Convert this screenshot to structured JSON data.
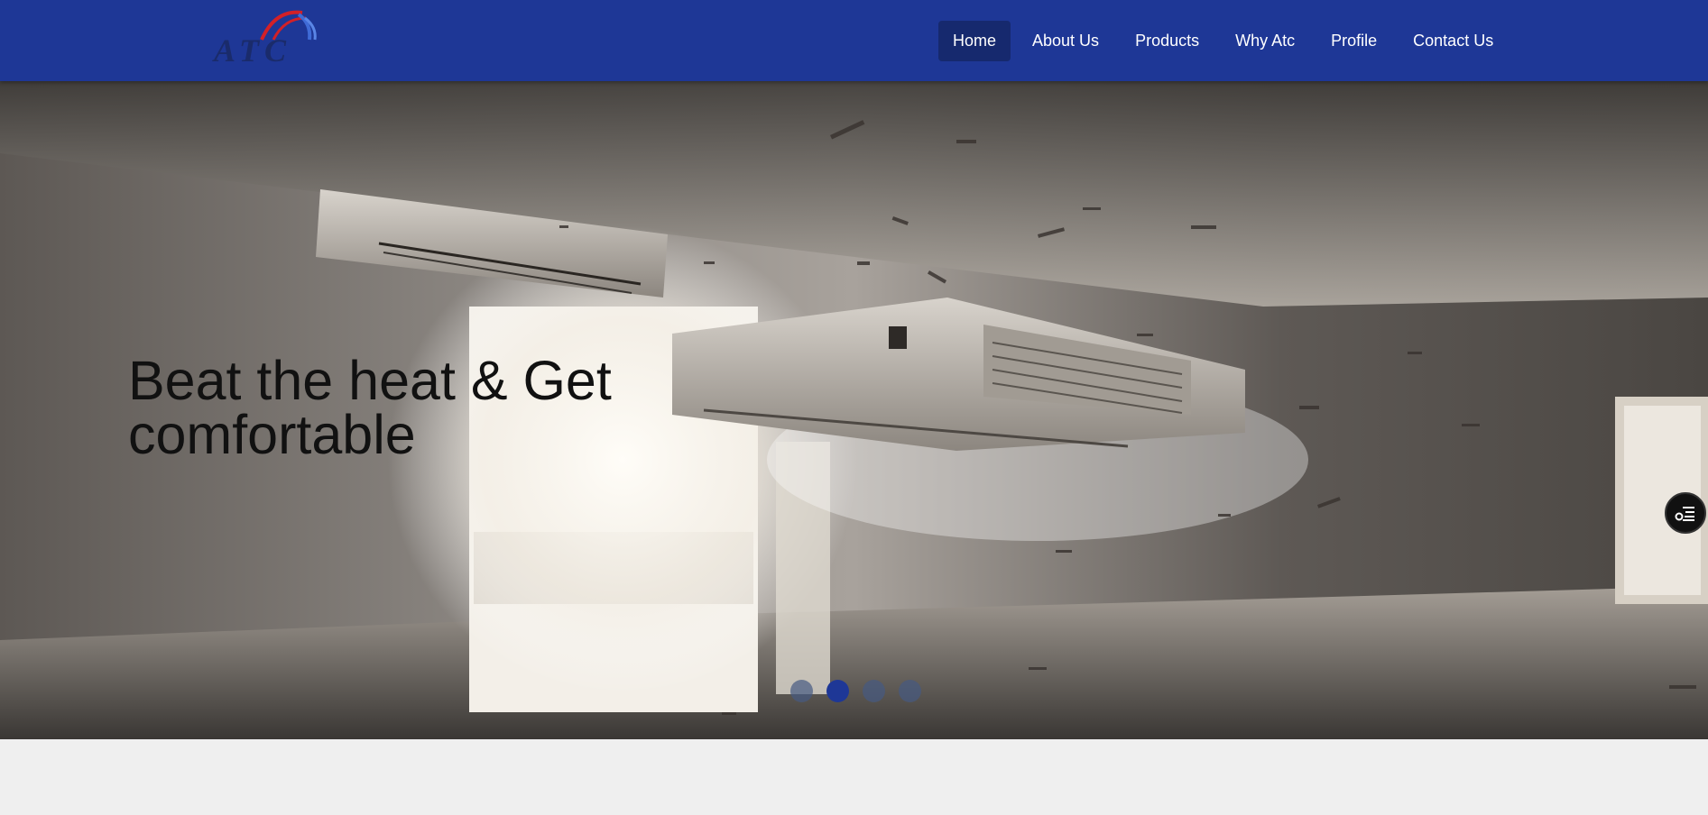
{
  "brand": {
    "logo_text": "ATC",
    "colors": {
      "navbar": "#1e3796",
      "active_nav": "#16296e",
      "logo_red": "#d32027",
      "logo_blue": "#1a2b6b"
    }
  },
  "nav": {
    "items": [
      {
        "label": "Home",
        "active": true
      },
      {
        "label": "About Us",
        "active": false
      },
      {
        "label": "Products",
        "active": false
      },
      {
        "label": "Why Atc",
        "active": false
      },
      {
        "label": "Profile",
        "active": false
      },
      {
        "label": "Contact Us",
        "active": false
      }
    ]
  },
  "hero": {
    "title": "Beat the heat & Get comfortable",
    "slides_count": 4,
    "active_slide": 2
  },
  "floating_button": {
    "icon": "filter-settings-icon"
  }
}
